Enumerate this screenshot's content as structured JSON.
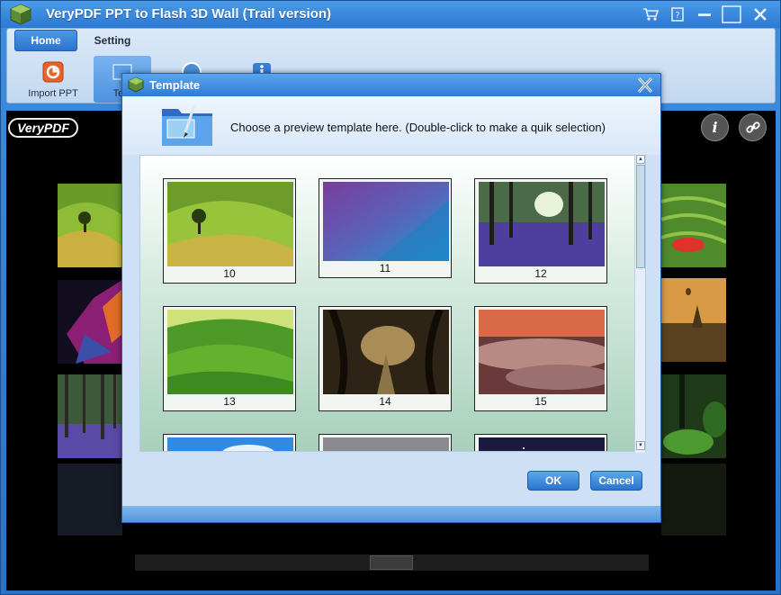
{
  "window": {
    "title": "VeryPDF PPT to Flash 3D Wall (Trail version)"
  },
  "titlebar_icons": {
    "cart": "cart-icon",
    "help": "help-icon",
    "minimize": "minimize-icon",
    "maximize": "maximize-icon",
    "close": "close-icon"
  },
  "ribbon": {
    "tabs": [
      {
        "label": "Home"
      },
      {
        "label": "Setting"
      }
    ],
    "buttons": [
      {
        "label": "Import PPT",
        "icon": "import-ppt-icon"
      },
      {
        "label": "Tem",
        "icon": "template-icon"
      },
      {
        "label": "",
        "icon": "publish-icon"
      },
      {
        "label": "",
        "icon": "info-icon"
      }
    ]
  },
  "viewer": {
    "logo": "VeryPDF",
    "info_icon": "i"
  },
  "dialog": {
    "title": "Template",
    "instruction": "Choose a preview template here. (Double-click to make a quik selection)",
    "templates": [
      {
        "label": "10"
      },
      {
        "label": "11"
      },
      {
        "label": "12"
      },
      {
        "label": "13"
      },
      {
        "label": "14"
      },
      {
        "label": "15"
      }
    ],
    "ok_label": "OK",
    "cancel_label": "Cancel"
  },
  "colors": {
    "titlebar": "#2c79d2",
    "ribbon": "#c2d8f1",
    "dialog_button": "#2c74cc"
  }
}
